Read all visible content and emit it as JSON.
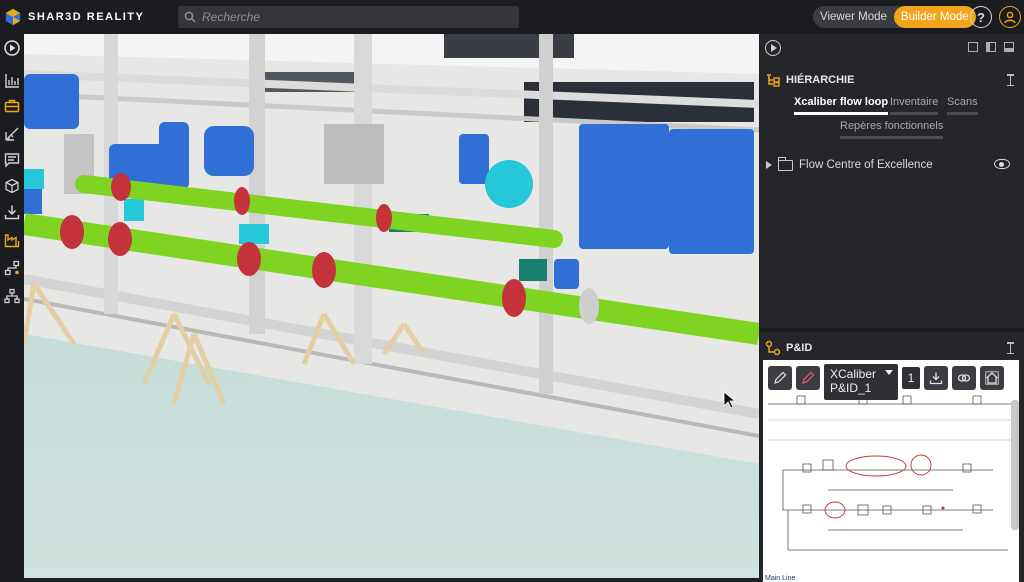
{
  "app": {
    "brand": "SHAR3D REALITY",
    "brand_colors": {
      "accent": "#f0a51d",
      "blue": "#2f6fd6"
    }
  },
  "search": {
    "placeholder": "Recherche",
    "value": ""
  },
  "modes": {
    "viewer_label": "Viewer Mode",
    "builder_label": "Builder Mode",
    "active": "Builder Mode"
  },
  "header_icons": {
    "help_glyph": "?",
    "help_icon": "help-circle-icon",
    "user_icon": "user-icon"
  },
  "sidebar": {
    "items": [
      {
        "name": "play",
        "icon": "play-circle-icon"
      },
      {
        "name": "measure",
        "icon": "chart-icon"
      },
      {
        "name": "equipment",
        "icon": "briefcase-icon",
        "active": true
      },
      {
        "name": "annotate",
        "icon": "ruler-icon"
      },
      {
        "name": "comments",
        "icon": "comment-icon"
      },
      {
        "name": "objects",
        "icon": "cube-icon"
      },
      {
        "name": "download",
        "icon": "download-icon"
      },
      {
        "name": "builder",
        "icon": "factory-icon",
        "active": true
      },
      {
        "name": "network",
        "icon": "network-icon"
      },
      {
        "name": "hierarchy",
        "icon": "tree-icon"
      }
    ]
  },
  "hierarchy": {
    "title": "HIÉRARCHIE",
    "tabs": [
      {
        "label": "Xcaliber flow loop",
        "active": true
      },
      {
        "label": "Inventaire",
        "active": false
      },
      {
        "label": "Scans",
        "active": false
      },
      {
        "label": "Repères fonctionnels",
        "active": false
      }
    ],
    "tree": [
      {
        "label": "Flow Centre of Excellence",
        "visible": true
      }
    ]
  },
  "pid": {
    "title": "P&ID",
    "document_select": "XCaliber P&ID_1",
    "page": "1",
    "footer": "Main Line"
  }
}
